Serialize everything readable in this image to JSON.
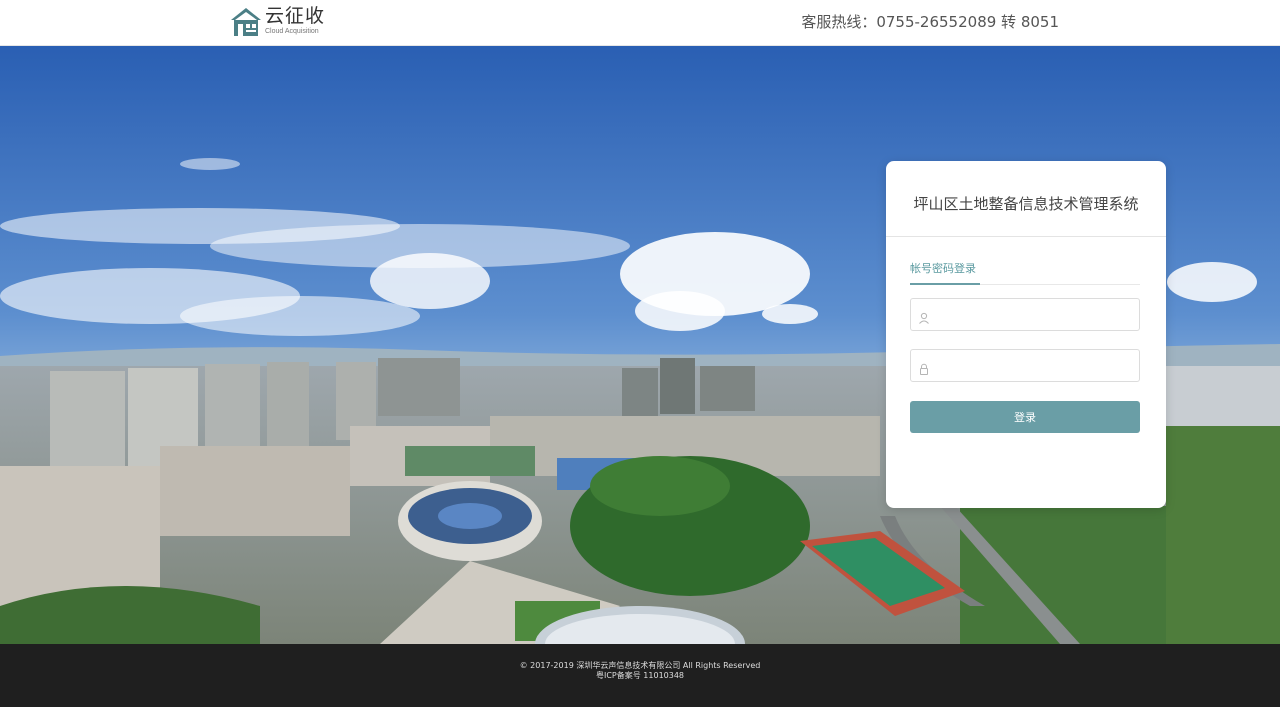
{
  "header": {
    "logo_title": "云征收",
    "logo_subtitle": "Cloud Acquisition",
    "hotline": "客服热线：0755-26552089 转 8051"
  },
  "login": {
    "system_title": "坪山区土地整备信息技术管理系统",
    "tab_label": "帐号密码登录",
    "username": {
      "value": "",
      "placeholder": "",
      "icon": "user-icon"
    },
    "password": {
      "value": "",
      "placeholder": "",
      "icon": "lock-icon"
    },
    "submit_label": "登录"
  },
  "footer": {
    "copyright": "© 2017-2019 深圳华云声信息技术有限公司 All Rights Reserved",
    "icp": "粤ICP备案号 11010348"
  },
  "colors": {
    "accent": "#6a9ea6",
    "footer_bg": "#1f1f1f",
    "sky_top": "#2b62b4",
    "sky_bottom": "#b9d3ea"
  }
}
